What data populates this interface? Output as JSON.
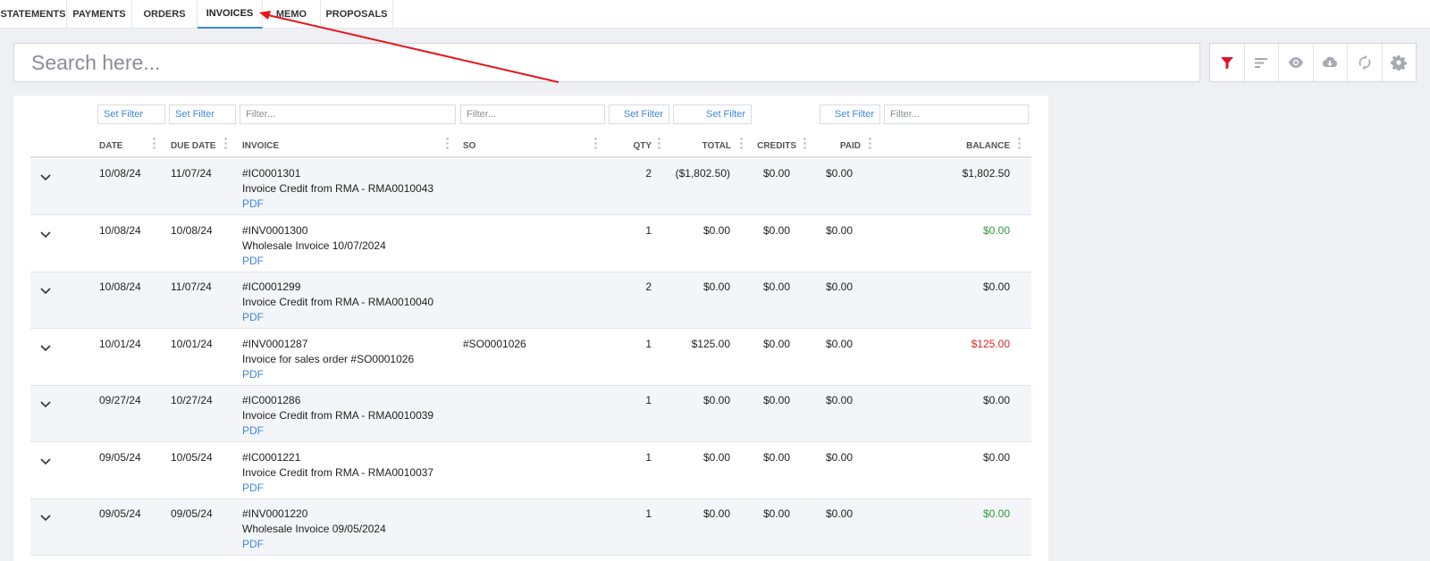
{
  "tabs": [
    {
      "label": "STATEMENTS",
      "active": false
    },
    {
      "label": "PAYMENTS",
      "active": false
    },
    {
      "label": "ORDERS",
      "active": false
    },
    {
      "label": "INVOICES",
      "active": true
    },
    {
      "label": "MEMO",
      "active": false
    },
    {
      "label": "PROPOSALS",
      "active": false
    }
  ],
  "search": {
    "placeholder": "Search here..."
  },
  "toolbar": {
    "icons": [
      "filter-icon",
      "sort-icon",
      "eye-icon",
      "cloud-download-icon",
      "refresh-icon",
      "gear-icon"
    ],
    "accent": "#e0142b"
  },
  "filters": {
    "set_filter": "Set Filter",
    "filter_placeholder": "Filter..."
  },
  "columns": {
    "date": "DATE",
    "due_date": "DUE DATE",
    "invoice": "INVOICE",
    "so": "SO",
    "qty": "QTY",
    "total": "TOTAL",
    "credits": "CREDITS",
    "paid": "PAID",
    "balance": "BALANCE"
  },
  "rows": [
    {
      "date": "10/08/24",
      "due": "11/07/24",
      "number": "#IC0001301",
      "desc": "Invoice Credit from RMA - RMA0010043",
      "link": "PDF",
      "so": "",
      "qty": "2",
      "total": "($1,802.50)",
      "credits": "$0.00",
      "paid": "$0.00",
      "balance": "$1,802.50",
      "balance_status": "normal"
    },
    {
      "date": "10/08/24",
      "due": "10/08/24",
      "number": "#INV0001300",
      "desc": "Wholesale Invoice 10/07/2024",
      "link": "PDF",
      "so": "",
      "qty": "1",
      "total": "$0.00",
      "credits": "$0.00",
      "paid": "$0.00",
      "balance": "$0.00",
      "balance_status": "green"
    },
    {
      "date": "10/08/24",
      "due": "11/07/24",
      "number": "#IC0001299",
      "desc": "Invoice Credit from RMA - RMA0010040",
      "link": "PDF",
      "so": "",
      "qty": "2",
      "total": "$0.00",
      "credits": "$0.00",
      "paid": "$0.00",
      "balance": "$0.00",
      "balance_status": "normal"
    },
    {
      "date": "10/01/24",
      "due": "10/01/24",
      "number": "#INV0001287",
      "desc": "Invoice for sales order #SO0001026",
      "link": "PDF",
      "so": "#SO0001026",
      "qty": "1",
      "total": "$125.00",
      "credits": "$0.00",
      "paid": "$0.00",
      "balance": "$125.00",
      "balance_status": "red"
    },
    {
      "date": "09/27/24",
      "due": "10/27/24",
      "number": "#IC0001286",
      "desc": "Invoice Credit from RMA - RMA0010039",
      "link": "PDF",
      "so": "",
      "qty": "1",
      "total": "$0.00",
      "credits": "$0.00",
      "paid": "$0.00",
      "balance": "$0.00",
      "balance_status": "normal"
    },
    {
      "date": "09/05/24",
      "due": "10/05/24",
      "number": "#IC0001221",
      "desc": "Invoice Credit from RMA - RMA0010037",
      "link": "PDF",
      "so": "",
      "qty": "1",
      "total": "$0.00",
      "credits": "$0.00",
      "paid": "$0.00",
      "balance": "$0.00",
      "balance_status": "normal"
    },
    {
      "date": "09/05/24",
      "due": "09/05/24",
      "number": "#INV0001220",
      "desc": "Wholesale Invoice 09/05/2024",
      "link": "PDF",
      "so": "",
      "qty": "1",
      "total": "$0.00",
      "credits": "$0.00",
      "paid": "$0.00",
      "balance": "$0.00",
      "balance_status": "green"
    }
  ],
  "colors": {
    "link": "#3d87d6",
    "positive": "#2d9a3a",
    "negative": "#e02424",
    "annotation_arrow": "#e8141b"
  }
}
